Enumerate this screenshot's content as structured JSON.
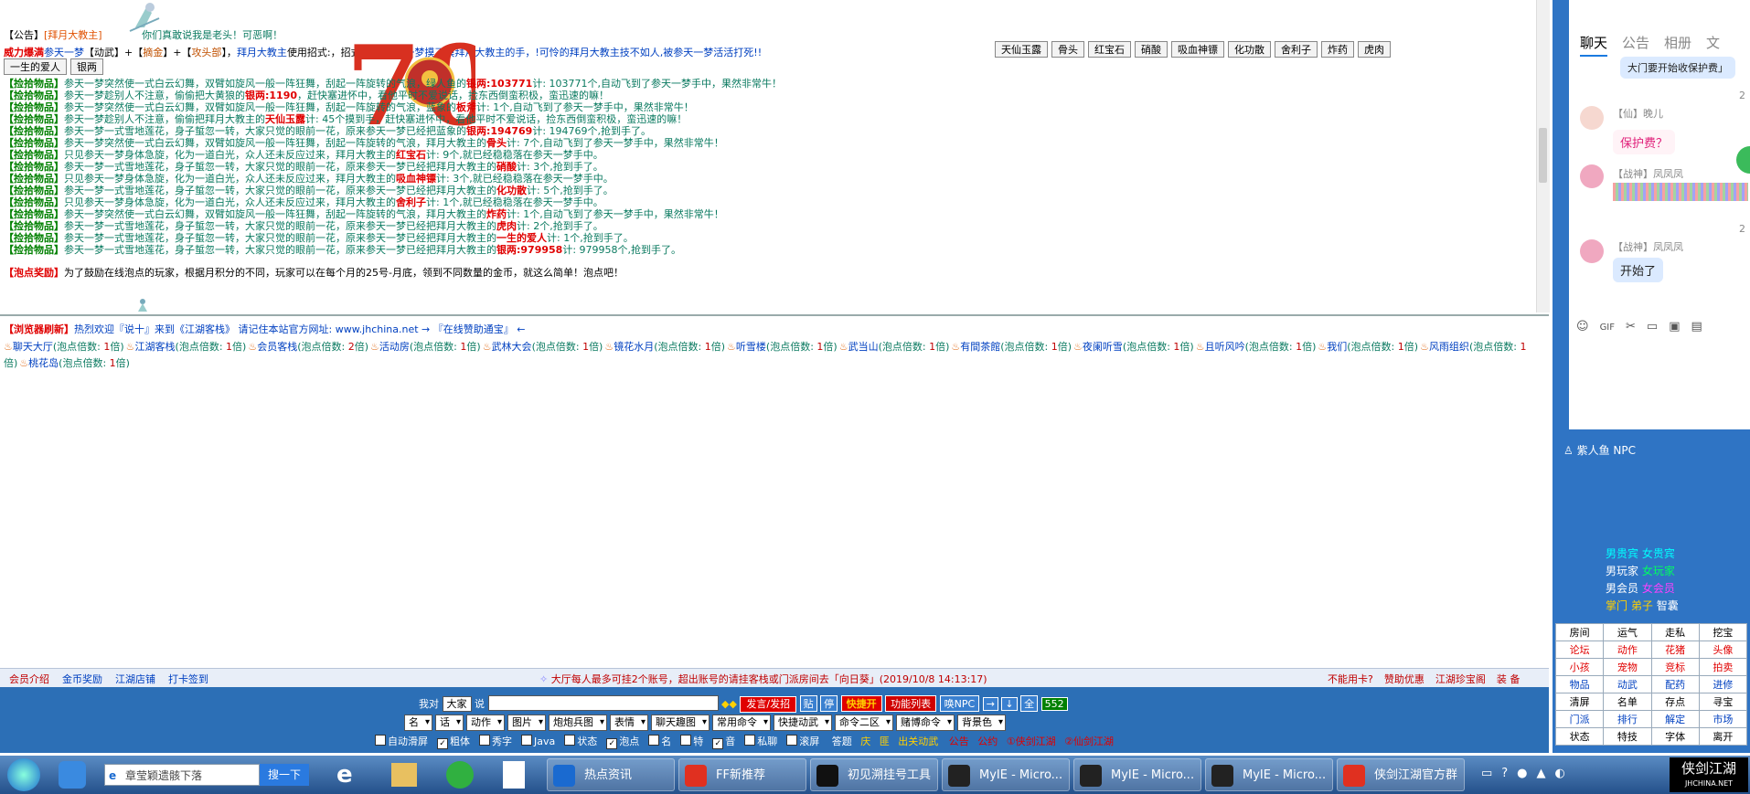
{
  "main": {
    "notice_tag": "【公告】",
    "notice_name": "[拜月大教主]",
    "notice_text": "你们真敢说我是老头！可恶啊！",
    "fight_prefix": "威力爆满",
    "fight_player": "参天一梦",
    "fight_text1": "【动武】+【",
    "fight_skill": "摘金",
    "fight_text2": "】+【",
    "fight_part": "攻头部",
    "fight_text3": "】，",
    "fight_target": "拜月大教主",
    "fight_text4": "使用招式:",
    "fight_text5": "，招式说明:",
    "fight_desc": "参天一梦摸了摸拜月大教主的手，!可怜的拜月大教主技不如人,被参天一梦活活打死!!",
    "items_row1": [
      "天仙玉露",
      "骨头",
      "红宝石",
      "硝酸",
      "吸血神镖",
      "化功散",
      "舍利子",
      "炸药",
      "虎肉"
    ],
    "items_row2": [
      "一生的爱人",
      "银两"
    ],
    "log_lines": [
      {
        "tag": "【捡拾物品】",
        "text": "参天一梦突然使一式白云幻舞，双臂如旋风一般一阵狂舞，刮起一阵旋转的气浪，绿人鱼的",
        "hl": "银两:103771",
        "rest": "计: 103771个,自动飞到了参天一梦手中，果然非常牛！"
      },
      {
        "tag": "【捡拾物品】",
        "text": "参天一梦趁别人不注意，偷偷把大黄狼的",
        "hl": "银两:1190",
        "rest": "，赶快塞进怀中，看他平时不爱说话，捡东西倒蛮积极，蛮迅速的嘛！"
      },
      {
        "tag": "【捡拾物品】",
        "text": "参天一梦突然使一式白云幻舞，双臂如旋风一般一阵狂舞，刮起一阵旋转的气浪，蓝象的",
        "hl": "板斧",
        "rest": "计: 1个,自动飞到了参天一梦手中，果然非常牛！"
      },
      {
        "tag": "【捡拾物品】",
        "text": "参天一梦趁别人不注意，偷偷把拜月大教主的",
        "hl": "天仙玉露",
        "rest": "计: 45个摸到手，赶快塞进怀中，看他平时不爱说话，捡东西倒蛮积极，蛮迅速的嘛！"
      },
      {
        "tag": "【捡拾物品】",
        "text": "参天一梦一式雪地莲花，身子蜇忽一转，大家只觉的眼前一花，原来参天一梦已经把蓝象的",
        "hl": "银两:194769",
        "rest": "计: 194769个,抢到手了。"
      },
      {
        "tag": "【捡拾物品】",
        "text": "参天一梦突然使一式白云幻舞，双臂如旋风一般一阵狂舞，刮起一阵旋转的气浪，拜月大教主的",
        "hl": "骨头",
        "rest": "计: 7个,自动飞到了参天一梦手中，果然非常牛！"
      },
      {
        "tag": "【捡拾物品】",
        "text": "只见参天一梦身体急旋，化为一道白光，众人还未反应过来，拜月大教主的",
        "hl": "红宝石",
        "rest": "计: 9个,就已经稳稳落在参天一梦手中。"
      },
      {
        "tag": "【捡拾物品】",
        "text": "参天一梦一式雪地莲花，身子蜇忽一转，大家只觉的眼前一花，原来参天一梦已经把拜月大教主的",
        "hl": "硝酸",
        "rest": "计: 3个,抢到手了。"
      },
      {
        "tag": "【捡拾物品】",
        "text": "只见参天一梦身体急旋，化为一道白光，众人还未反应过来，拜月大教主的",
        "hl": "吸血神镖",
        "rest": "计: 3个,就已经稳稳落在参天一梦手中。"
      },
      {
        "tag": "【捡拾物品】",
        "text": "参天一梦一式雪地莲花，身子蜇忽一转，大家只觉的眼前一花，原来参天一梦已经把拜月大教主的",
        "hl": "化功散",
        "rest": "计: 5个,抢到手了。"
      },
      {
        "tag": "【捡拾物品】",
        "text": "只见参天一梦身体急旋，化为一道白光，众人还未反应过来，拜月大教主的",
        "hl": "舍利子",
        "rest": "计: 1个,就已经稳稳落在参天一梦手中。"
      },
      {
        "tag": "【捡拾物品】",
        "text": "参天一梦突然使一式白云幻舞，双臂如旋风一般一阵狂舞，刮起一阵旋转的气浪，拜月大教主的",
        "hl": "炸药",
        "rest": "计: 1个,自动飞到了参天一梦手中，果然非常牛！"
      },
      {
        "tag": "【捡拾物品】",
        "text": "参天一梦一式雪地莲花，身子蜇忽一转，大家只觉的眼前一花，原来参天一梦已经把拜月大教主的",
        "hl": "虎肉",
        "rest": "计: 2个,抢到手了。"
      },
      {
        "tag": "【捡拾物品】",
        "text": "参天一梦一式雪地莲花，身子蜇忽一转，大家只觉的眼前一花，原来参天一梦已经把拜月大教主的",
        "hl": "一生的爱人",
        "rest": "计: 1个,抢到手了。"
      },
      {
        "tag": "【捡拾物品】",
        "text": "参天一梦一式雪地莲花，身子蜇忽一转，大家只觉的眼前一花，原来参天一梦已经把拜月大教主的",
        "hl": "银两:979958",
        "rest": "计: 979958个,抢到手了。"
      }
    ],
    "bonus_tag": "【泡点奖励】",
    "bonus_text": "为了鼓励在线泡点的玩家，根据月积分的不同，玩家可以在每个月的25号-月底，领到不同数量的金币，就这么简单！泡点吧！"
  },
  "public": {
    "refresh_tag": "【浏览器刷新】",
    "welcome": "热烈欢迎『说十』来到《江湖客栈》 请记住本站官方网址: www.jhchina.net → 『在线赞助通宝』 ←",
    "rooms": [
      {
        "name": "聊天大厅",
        "mult": "1"
      },
      {
        "name": "江湖客栈",
        "mult": "1"
      },
      {
        "name": "会员客栈",
        "mult": "2"
      },
      {
        "name": "活动房",
        "mult": "1"
      },
      {
        "name": "武林大会",
        "mult": "1"
      },
      {
        "name": "镜花水月",
        "mult": "1"
      },
      {
        "name": "听雪楼",
        "mult": "1"
      },
      {
        "name": "武当山",
        "mult": "1"
      },
      {
        "name": "有間茶館",
        "mult": "1"
      },
      {
        "name": "夜阑听雪",
        "mult": "1"
      },
      {
        "name": "且听风吟",
        "mult": "1"
      },
      {
        "name": "我们",
        "mult": "1"
      },
      {
        "name": "风雨组织",
        "mult": "1"
      },
      {
        "name": "桃花岛",
        "mult": "1"
      }
    ],
    "mult_label_open": "(泡点倍数: ",
    "mult_label_close": "倍)"
  },
  "notice_bar": {
    "links_left": [
      "会员介绍",
      "金币奖励",
      "江湖店铺",
      "打卡签到"
    ],
    "center": "大厅每人最多可挂2个账号，超出账号的请挂客栈或门派房间去「向日葵」(2019/10/8 14:13:17)",
    "links_right": [
      "不能用卡?",
      "赞助优惠",
      "江湖珍宝阁",
      "装 备"
    ]
  },
  "control": {
    "say_to_label": "我对",
    "target": "大家",
    "say_label": "说",
    "send_btn": "发言/发招",
    "paste_btn": "贴",
    "stop_btn": "停",
    "fast_btn": "快捷开",
    "func_btn": "功能列表",
    "npc_btn": "唤NPC",
    "arrows": [
      "→",
      "↓",
      "全"
    ],
    "count": "552",
    "selects": [
      "名",
      "话",
      "动作",
      "图片",
      "炮炮兵图",
      "表情",
      "聊天趣图",
      "常用命令",
      "快捷动武",
      "命令二区",
      "赌博命令",
      "背景色"
    ],
    "checks": [
      {
        "label": "自动滑屏",
        "checked": false
      },
      {
        "label": "粗体",
        "checked": true
      },
      {
        "label": "秀字",
        "checked": false
      },
      {
        "label": "Java",
        "checked": false
      },
      {
        "label": "状态",
        "checked": false
      },
      {
        "label": "泡点",
        "checked": true
      },
      {
        "label": "名",
        "checked": false
      },
      {
        "label": "特",
        "checked": false
      },
      {
        "label": "音",
        "checked": true
      },
      {
        "label": "私聊",
        "checked": false
      },
      {
        "label": "滚屏",
        "checked": false
      }
    ],
    "extra": [
      "答题",
      "庆",
      "匪",
      "出关动武",
      "公告",
      "公约",
      "①侠剑江湖",
      "②仙剑江湖"
    ]
  },
  "qq": {
    "tabs": [
      "聊天",
      "公告",
      "相册",
      "文"
    ],
    "top_bubble": "大门要开始收保护费」",
    "time1": "2",
    "user1": "【仙】晚儿",
    "msg1": "保护费？",
    "user2": "【战神】凤凤凤",
    "time2": "2",
    "user3": "【战神】凤凤凤",
    "msg3": "开始了"
  },
  "right": {
    "npc": "紫人鱼 NPC",
    "legend": [
      {
        "a": "男贵宾",
        "b": "女贵宾"
      },
      {
        "a": "男玩家",
        "b": "女玩家"
      },
      {
        "a": "男会员",
        "b": "女会员"
      }
    ],
    "legend4": [
      "掌门",
      "弟子",
      "智囊"
    ],
    "menu": [
      [
        "房间",
        "运气",
        "走私",
        "挖宝"
      ],
      [
        "论坛",
        "动作",
        "花猪",
        "头像"
      ],
      [
        "小孩",
        "宠物",
        "竞标",
        "拍卖"
      ],
      [
        "物品",
        "动武",
        "配药",
        "进修"
      ],
      [
        "清屏",
        "名单",
        "存点",
        "寻宝"
      ],
      [
        "门派",
        "排行",
        "解定",
        "市场"
      ],
      [
        "状态",
        "特技",
        "字体",
        "离开"
      ]
    ]
  },
  "taskbar": {
    "search_placeholder": "章莹颖遗骸下落",
    "search_btn": "搜一下",
    "tasks": [
      "热点资讯",
      "FF新推荐",
      "初见溯挂号工具",
      "MyIE - Micro...",
      "MyIE - Micro...",
      "MyIE - Micro...",
      "侠剑江湖官方群"
    ],
    "tray_logo": "侠剑江湖",
    "tray_url": "JHCHINA.NET"
  }
}
